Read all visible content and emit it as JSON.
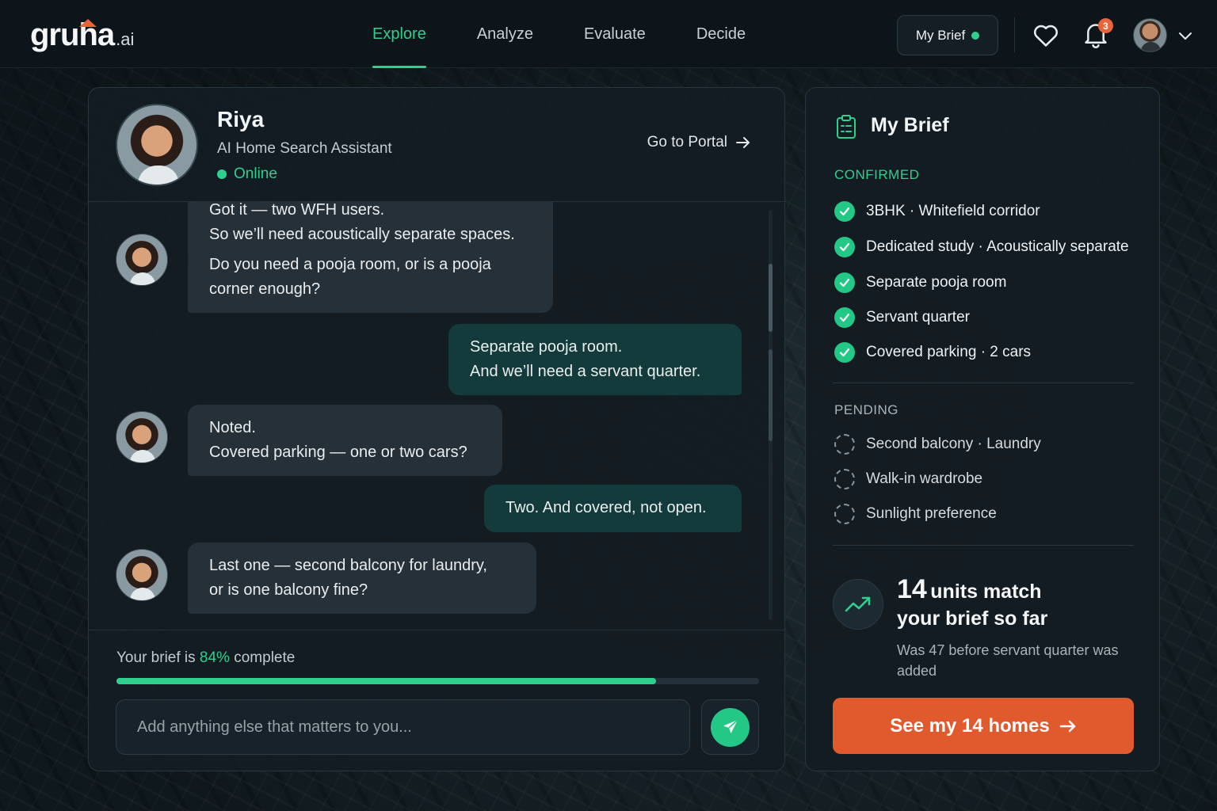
{
  "logo": {
    "main": "gruha",
    "suffix": ".ai"
  },
  "nav": {
    "tabs": [
      {
        "label": "Explore",
        "active": true
      },
      {
        "label": "Analyze",
        "active": false
      },
      {
        "label": "Evaluate",
        "active": false
      },
      {
        "label": "Decide",
        "active": false
      }
    ],
    "brief_button": "My Brief",
    "notification_count": "3"
  },
  "assistant": {
    "name": "Riya",
    "role": "AI Home Search Assistant",
    "status": "Online",
    "portal_link": "Go to Portal"
  },
  "messages": [
    {
      "from": "assistant",
      "lines": [
        "Got it — two WFH users.",
        "So we’ll need acoustically separate spaces.",
        "Do you need a pooja room, or is a pooja",
        "corner enough?"
      ]
    },
    {
      "from": "user",
      "lines": [
        "Separate pooja room.",
        "And we’ll need a servant quarter."
      ]
    },
    {
      "from": "assistant",
      "lines": [
        "Noted.",
        "Covered parking — one or two cars?"
      ]
    },
    {
      "from": "user",
      "lines": [
        "Two. And covered, not open."
      ]
    },
    {
      "from": "assistant",
      "lines": [
        "Last one — second balcony for laundry,",
        "or is one balcony fine?"
      ]
    }
  ],
  "progress": {
    "prefix": "Your brief is",
    "percent_label": "84%",
    "suffix": "complete",
    "value": 0.84
  },
  "input": {
    "placeholder": "Add anything else that matters to you...",
    "value": ""
  },
  "brief": {
    "title": "My Brief",
    "confirmed_label": "CONFIRMED",
    "confirmed": [
      "3BHK · Whitefield corridor",
      "Dedicated study · Acoustically separate",
      "Separate pooja room",
      "Servant quarter",
      "Covered parking · 2 cars"
    ],
    "pending_label": "PENDING",
    "pending": [
      "Second balcony · Laundry",
      "Walk-in wardrobe",
      "Sunlight preference"
    ],
    "match_count": "14",
    "match_text_1": "units match",
    "match_text_2": "your brief so far",
    "match_note": "Was 47 before servant quarter was added",
    "cta": "See my 14 homes"
  },
  "colors": {
    "accent": "#2fd08e",
    "cta": "#e05a2e",
    "background": "#131d22"
  }
}
